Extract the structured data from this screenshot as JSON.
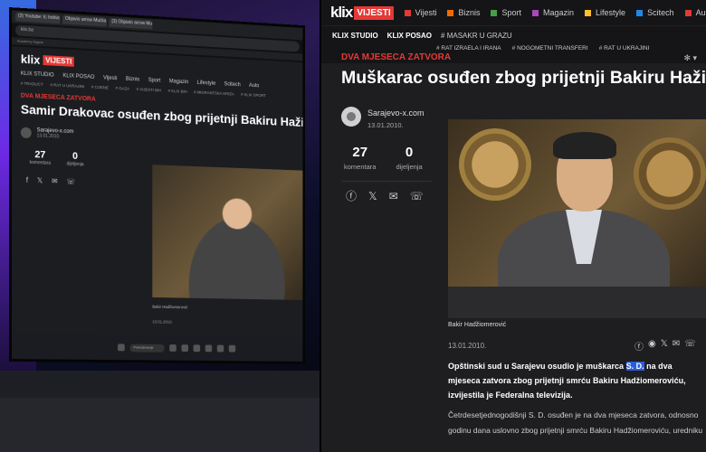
{
  "monitor": {
    "tabs": [
      "(3) Youtube: Ic Individualni",
      "Objavio arrow Mućkac",
      "(3) Objavio arrow Mućkac"
    ],
    "url": "klix.ba",
    "bookmarks": "Academy Digest",
    "logo": "klix",
    "logo_badge": "VIJESTI",
    "nav": [
      "KLIX STUDIO",
      "KLIX POSAO",
      "Vijesti",
      "Biznis",
      "Sport",
      "Magazin",
      "Lifestyle",
      "Scitech",
      "Auto"
    ],
    "nav2": [
      "# TRADUCT",
      "# RAT U UKRAJINI",
      "# CIJENE",
      "# GAZA",
      "# VIJESTI BiH",
      "# KLIX BIH",
      "# MIGRANTSKA KRIZA",
      "# KLIX SPORT"
    ],
    "kicker": "DVA MJESECA ZATVORA",
    "title": "Samir Drakovac osuđen zbog prijetnji Bakiru Hažiomerov",
    "author": "Sarajevo-x.com",
    "date": "13.01.2010.",
    "comments_count": "27",
    "comments_label": "komentara",
    "shares_count": "0",
    "shares_label": "dijeljenja",
    "caption": "Bakir Hadžiomerović",
    "date2": "13.01.2010.",
    "taskbar_search": "Pretraživanje"
  },
  "site": {
    "logo": "klix",
    "logo_badge": "VIJESTI",
    "categories": [
      {
        "label": "Vijesti",
        "color": "#e53935"
      },
      {
        "label": "Biznis",
        "color": "#ef6c00"
      },
      {
        "label": "Sport",
        "color": "#43a047"
      },
      {
        "label": "Magazin",
        "color": "#ab47bc"
      },
      {
        "label": "Lifestyle",
        "color": "#fbc02d"
      },
      {
        "label": "Scitech",
        "color": "#1e88e5"
      },
      {
        "label": "Auto",
        "color": "#e53935"
      }
    ],
    "studio": "KLIX STUDIO",
    "posao": "KLIX POSAO",
    "tags_row1": [
      "# MASAKR U GRAZU",
      "# RAT IZRAELA I IRANA",
      "# NOGOMETNI TRANSFERI"
    ],
    "tags_row2": [
      "# RAT U UKRAJINI"
    ],
    "kicker": "DVA MJESECA ZATVORA",
    "title": "Muškarac osuđen zbog prijetnji Bakiru Hažiomeroviću",
    "author": "Sarajevo-x.com",
    "date": "13.01.2010.",
    "comments_count": "27",
    "comments_label": "komentara",
    "shares_count": "0",
    "shares_label": "dijeljenja",
    "caption": "Bakir Hadžiomerović",
    "date2": "13.01.2010.",
    "lead_before": "Opštinski sud u Sarajevu osudio je muškarca ",
    "lead_highlight": "S. D.",
    "lead_after": " na dva mjeseca zatvora zbog prijetnji smrću Bakiru Hadžiomeroviću, izvijestila je Federalna televizija.",
    "body": "Četrdesetjednogodišnji S. D. osuđen je na dva mjeseca zatvora, odnosno godinu dana uslovno zbog prijetnji smrću Bakiru Hadžiomeroviću, uredniku"
  }
}
